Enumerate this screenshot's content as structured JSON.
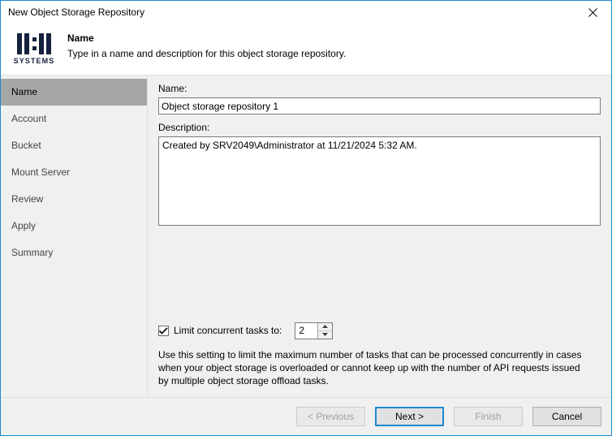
{
  "window": {
    "title": "New Object Storage Repository",
    "close_icon": "close-icon",
    "border_color": "#1d8ad1"
  },
  "header": {
    "logo": {
      "brand": "11:11",
      "word": "SYSTEMS",
      "color": "#14223d"
    },
    "title": "Name",
    "subtitle": "Type in a name and description for this object storage repository."
  },
  "sidebar": {
    "selected_index": 0,
    "items": [
      {
        "label": "Name"
      },
      {
        "label": "Account"
      },
      {
        "label": "Bucket"
      },
      {
        "label": "Mount Server"
      },
      {
        "label": "Review"
      },
      {
        "label": "Apply"
      },
      {
        "label": "Summary"
      }
    ]
  },
  "form": {
    "name_label": "Name:",
    "name_value": "Object storage repository 1",
    "name_placeholder": "",
    "description_label": "Description:",
    "description_value": "Created by SRV2049\\Administrator at 11/21/2024 5:32 AM.",
    "description_placeholder": "",
    "limit_checkbox_label": "Limit concurrent tasks to:",
    "limit_checkbox_checked": true,
    "limit_value": "2",
    "limit_description": "Use this setting to limit the maximum number of tasks that can be processed concurrently in cases when your object storage is overloaded or cannot keep up with the number of API requests issued by multiple object storage offload tasks."
  },
  "footer": {
    "previous_label": "< Previous",
    "previous_enabled": false,
    "next_label": "Next >",
    "next_enabled": true,
    "finish_label": "Finish",
    "finish_enabled": false,
    "cancel_label": "Cancel",
    "cancel_enabled": true
  }
}
